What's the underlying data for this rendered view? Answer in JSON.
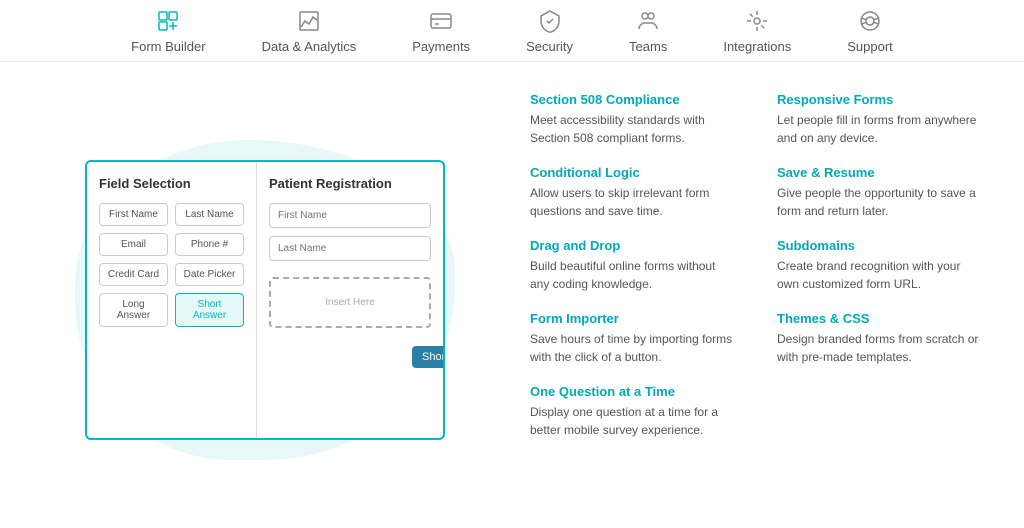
{
  "nav": {
    "items": [
      {
        "id": "form-builder",
        "label": "Form Builder",
        "icon": "form"
      },
      {
        "id": "data-analytics",
        "label": "Data & Analytics",
        "icon": "chart"
      },
      {
        "id": "payments",
        "label": "Payments",
        "icon": "payments"
      },
      {
        "id": "security",
        "label": "Security",
        "icon": "security"
      },
      {
        "id": "teams",
        "label": "Teams",
        "icon": "teams"
      },
      {
        "id": "integrations",
        "label": "Integrations",
        "icon": "integrations"
      },
      {
        "id": "support",
        "label": "Support",
        "icon": "support"
      }
    ]
  },
  "preview": {
    "field_selection_title": "Field Selection",
    "form_title": "Patient Registration",
    "fields": [
      "First Name",
      "Last Name",
      "Email",
      "Phone #",
      "Credit Card",
      "Date Picker",
      "Long Answer",
      "Short Answer"
    ],
    "inputs": [
      "First Name",
      "Last Name"
    ],
    "drop_hint": "Insert Here",
    "drag_label": "Short Answer"
  },
  "features": {
    "col1": [
      {
        "title": "Section 508 Compliance",
        "desc": "Meet accessibility standards with Section 508 compliant forms."
      },
      {
        "title": "Conditional Logic",
        "desc": "Allow users to skip irrelevant form questions and save time."
      },
      {
        "title": "Drag and Drop",
        "desc": "Build beautiful online forms without any coding knowledge."
      },
      {
        "title": "Form Importer",
        "desc": "Save hours of time by importing forms with the click of a button."
      },
      {
        "title": "One Question at a Time",
        "desc": "Display one question at a time for a better mobile survey experience."
      }
    ],
    "col2": [
      {
        "title": "Responsive Forms",
        "desc": "Let people fill in forms from anywhere and on any device."
      },
      {
        "title": "Save & Resume",
        "desc": "Give people the opportunity to save a form and return later."
      },
      {
        "title": "Subdomains",
        "desc": "Create brand recognition with your own customized form URL."
      },
      {
        "title": "Themes & CSS",
        "desc": "Design branded forms from scratch or with pre-made templates."
      }
    ]
  }
}
